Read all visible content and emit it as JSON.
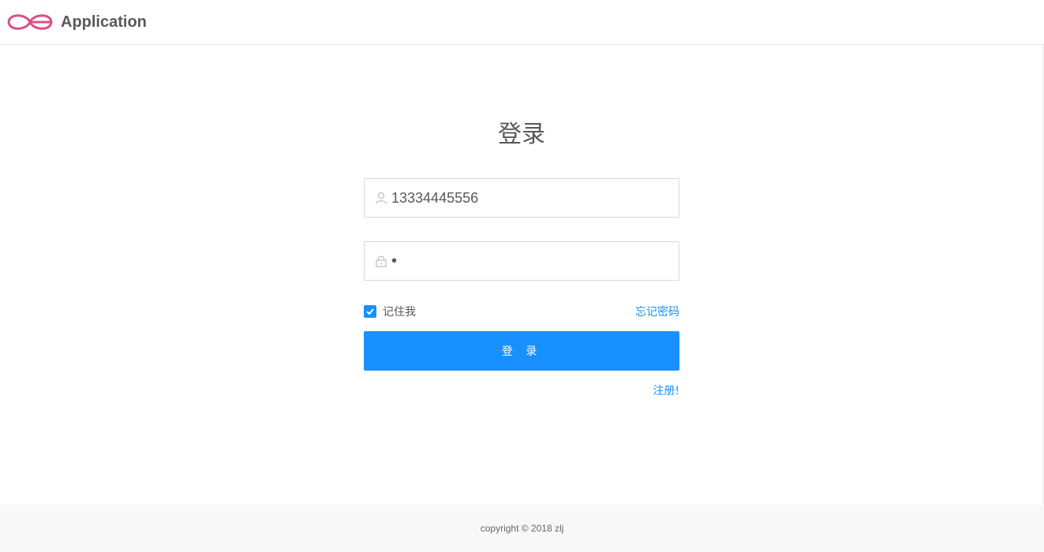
{
  "header": {
    "app_title": "Application",
    "logo": "oe-logo",
    "logo_color": "#d94f86"
  },
  "login": {
    "title": "登录",
    "username": {
      "value": "13334445556",
      "icon": "user-icon"
    },
    "password": {
      "value": "•",
      "icon": "lock-icon"
    },
    "remember_me": {
      "label": "记住我",
      "checked": true
    },
    "forgot_password": "忘记密码",
    "submit_label": "登 录",
    "register_link": "注册!"
  },
  "footer": {
    "copyright": "copyright © 2018 zlj"
  },
  "colors": {
    "primary": "#1890ff",
    "text": "#595959",
    "border": "#d9d9d9"
  }
}
